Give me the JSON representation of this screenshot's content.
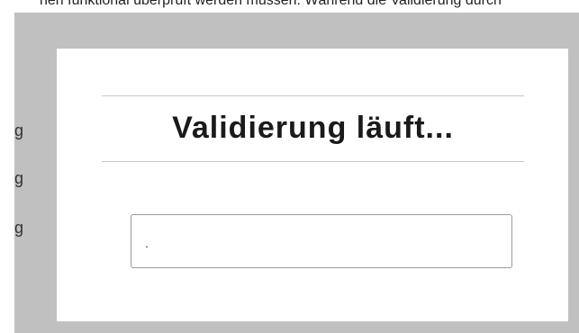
{
  "background": {
    "top_text": "nen funktional überprüft werden müssen. Während die Validierung durch",
    "side_glyphs": [
      "g",
      "g",
      "g"
    ]
  },
  "overlay": {
    "color": "#c0c0c0"
  },
  "dialog": {
    "title": "Validierung läuft...",
    "progress_text": "."
  }
}
